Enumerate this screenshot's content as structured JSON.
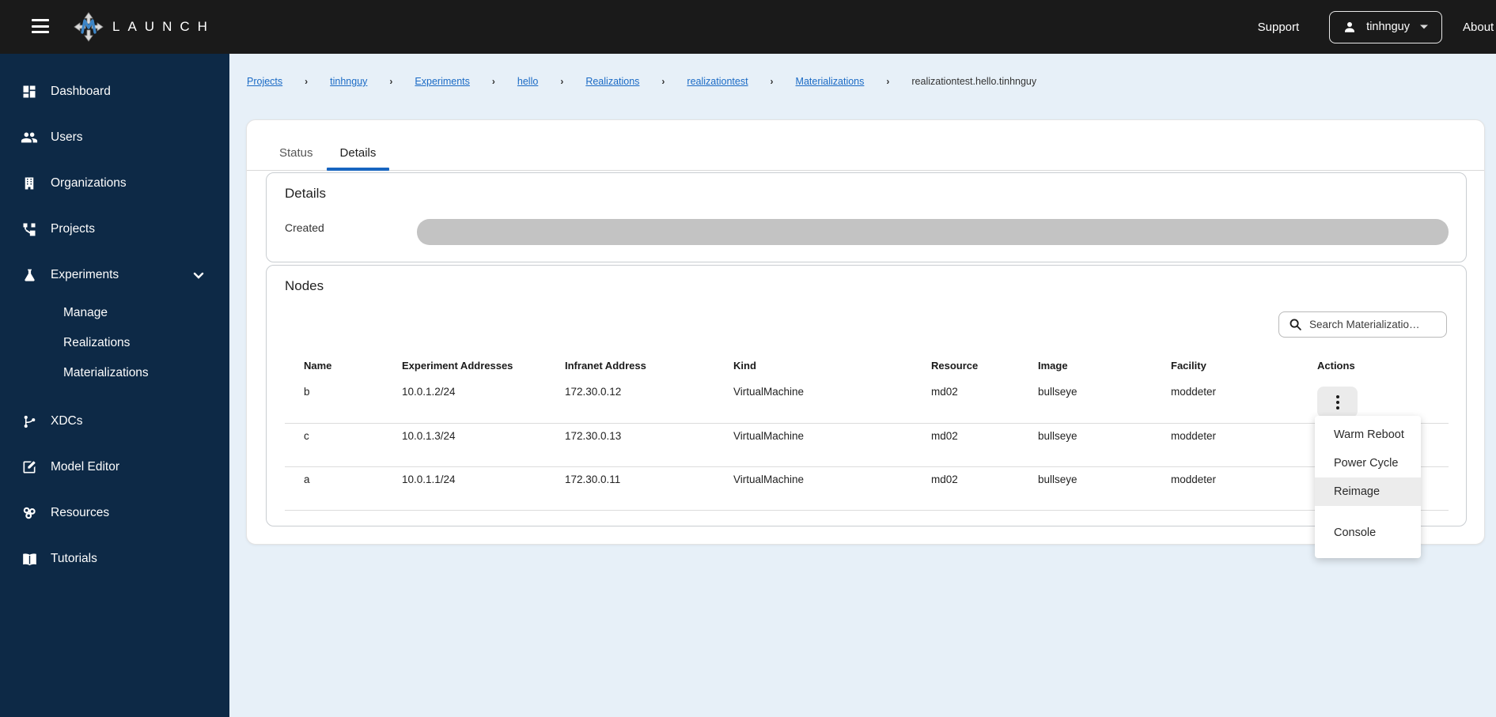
{
  "topbar": {
    "brand": "LAUNCH",
    "support_label": "Support",
    "username": "tinhnguy",
    "about_label": "About"
  },
  "sidebar": {
    "items": [
      {
        "label": "Dashboard"
      },
      {
        "label": "Users"
      },
      {
        "label": "Organizations"
      },
      {
        "label": "Projects"
      },
      {
        "label": "Experiments"
      },
      {
        "label": "XDCs"
      },
      {
        "label": "Model Editor"
      },
      {
        "label": "Resources"
      },
      {
        "label": "Tutorials"
      }
    ],
    "sub_items": [
      "Manage",
      "Realizations",
      "Materializations"
    ]
  },
  "breadcrumb": {
    "links": [
      "Projects",
      "tinhnguy",
      "Experiments",
      "hello",
      "Realizations",
      "realizationtest",
      "Materializations"
    ],
    "separator": "›",
    "current": "realizationtest.hello.tinhnguy"
  },
  "tabs": [
    {
      "label": "Status",
      "active": false
    },
    {
      "label": "Details",
      "active": true
    }
  ],
  "details_card": {
    "title": "Details",
    "created_label": "Created"
  },
  "nodes_card": {
    "title": "Nodes",
    "search_placeholder": "Search Materializatio…",
    "table": {
      "headers": [
        "Name",
        "Experiment Addresses",
        "Infranet Address",
        "Kind",
        "Resource",
        "Image",
        "Facility",
        "Actions"
      ],
      "rows": [
        {
          "name": "b",
          "experiment_addresses": "10.0.1.2/24",
          "infranet_address": "172.30.0.12",
          "kind": "VirtualMachine",
          "resource": "md02",
          "image": "bullseye",
          "facility": "moddeter"
        },
        {
          "name": "c",
          "experiment_addresses": "10.0.1.3/24",
          "infranet_address": "172.30.0.13",
          "kind": "VirtualMachine",
          "resource": "md02",
          "image": "bullseye",
          "facility": "moddeter"
        },
        {
          "name": "a",
          "experiment_addresses": "10.0.1.1/24",
          "infranet_address": "172.30.0.11",
          "kind": "VirtualMachine",
          "resource": "md02",
          "image": "bullseye",
          "facility": "moddeter"
        }
      ]
    }
  },
  "actions_menu": {
    "items": [
      "Warm Reboot",
      "Power Cycle",
      "Reimage",
      "Console"
    ],
    "highlighted": "Reimage"
  },
  "colors": {
    "topbar_bg": "#1a1a1a",
    "sidebar_bg": "#0d2946",
    "main_bg": "#e7f0f8",
    "link_blue": "#1a6ac5",
    "tab_underline": "#1765c0",
    "skeleton_gray": "#c3c3c3",
    "logo_blue": "#3d85c6"
  }
}
